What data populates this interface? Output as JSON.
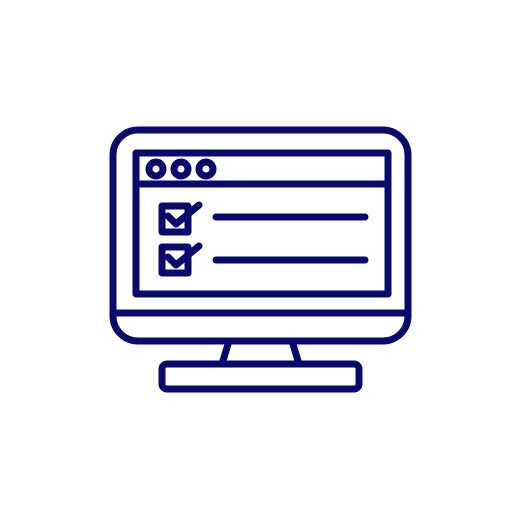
{
  "icon": {
    "name": "computer-monitor-checklist-icon",
    "stroke_color": "#0a0a6e",
    "background_color": "#ffffff",
    "window_dots": 3,
    "checklist": [
      {
        "checked": true
      },
      {
        "checked": true
      }
    ]
  }
}
